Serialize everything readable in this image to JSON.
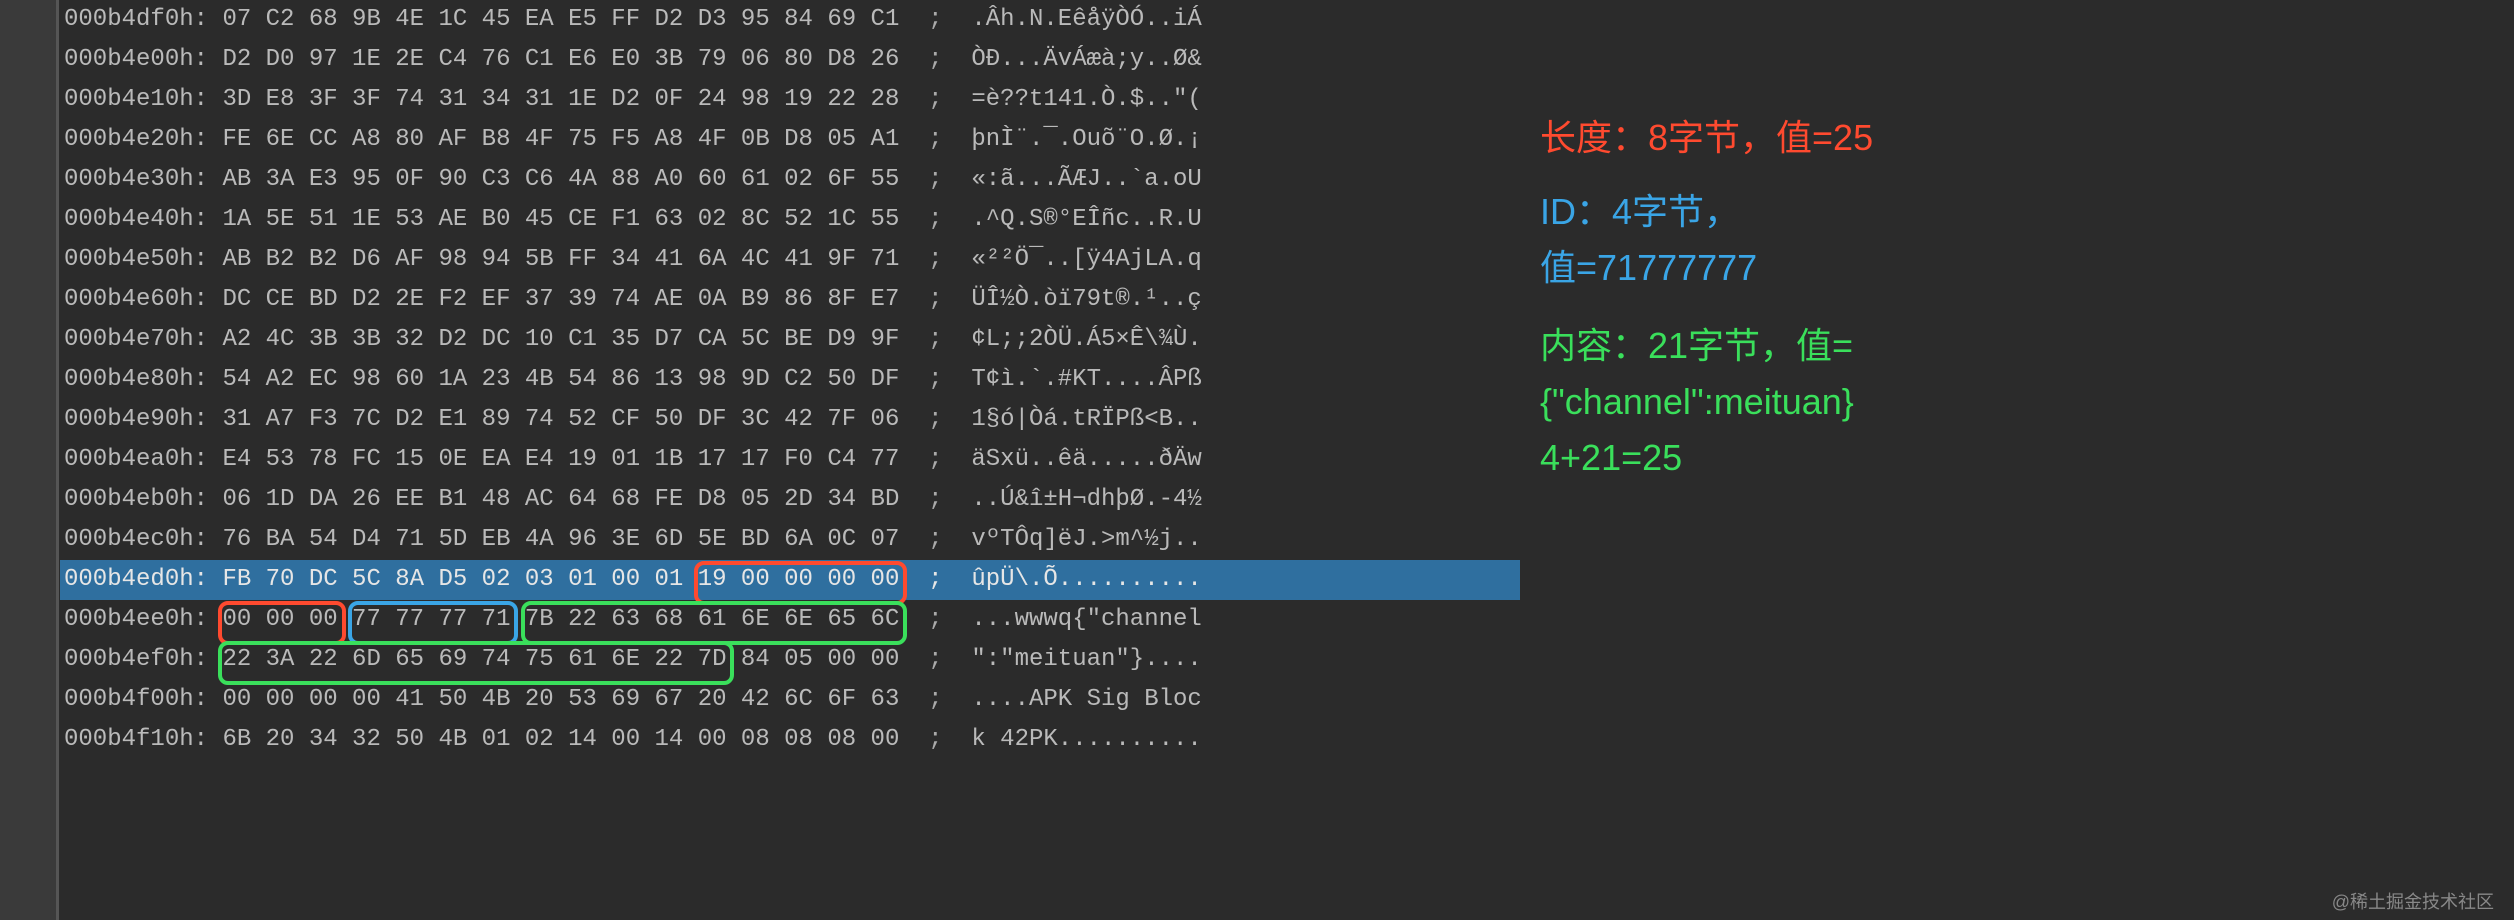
{
  "lines": [
    {
      "offset": "000b4df0h:",
      "bytes": "07 C2 68 9B 4E 1C 45 EA E5 FF D2 D3 95 84 69 C1",
      "ascii": ".Âh.N.EêåÿÒÓ..iÁ",
      "hl": false
    },
    {
      "offset": "000b4e00h:",
      "bytes": "D2 D0 97 1E 2E C4 76 C1 E6 E0 3B 79 06 80 D8 26",
      "ascii": "ÒÐ...ÄvÁæà;y..Ø&",
      "hl": false
    },
    {
      "offset": "000b4e10h:",
      "bytes": "3D E8 3F 3F 74 31 34 31 1E D2 0F 24 98 19 22 28",
      "ascii": "=è??t141.Ò.$..\"(",
      "hl": false
    },
    {
      "offset": "000b4e20h:",
      "bytes": "FE 6E CC A8 80 AF B8 4F 75 F5 A8 4F 0B D8 05 A1",
      "ascii": "þnÌ¨.¯.Ouõ¨O.Ø.¡",
      "hl": false
    },
    {
      "offset": "000b4e30h:",
      "bytes": "AB 3A E3 95 0F 90 C3 C6 4A 88 A0 60 61 02 6F 55",
      "ascii": "«:ã...ÃÆJ..`a.oU",
      "hl": false
    },
    {
      "offset": "000b4e40h:",
      "bytes": "1A 5E 51 1E 53 AE B0 45 CE F1 63 02 8C 52 1C 55",
      "ascii": ".^Q.S®°EÎñc..R.U",
      "hl": false
    },
    {
      "offset": "000b4e50h:",
      "bytes": "AB B2 B2 D6 AF 98 94 5B FF 34 41 6A 4C 41 9F 71",
      "ascii": "«²²Ö¯..[ÿ4AjLA.q",
      "hl": false
    },
    {
      "offset": "000b4e60h:",
      "bytes": "DC CE BD D2 2E F2 EF 37 39 74 AE 0A B9 86 8F E7",
      "ascii": "ÜÎ½Ò.òï79t®.¹..ç",
      "hl": false
    },
    {
      "offset": "000b4e70h:",
      "bytes": "A2 4C 3B 3B 32 D2 DC 10 C1 35 D7 CA 5C BE D9 9F",
      "ascii": "¢L;;2ÒÜ.Á5×Ê\\¾Ù.",
      "hl": false
    },
    {
      "offset": "000b4e80h:",
      "bytes": "54 A2 EC 98 60 1A 23 4B 54 86 13 98 9D C2 50 DF",
      "ascii": "T¢ì.`.#KT....ÂPß",
      "hl": false
    },
    {
      "offset": "000b4e90h:",
      "bytes": "31 A7 F3 7C D2 E1 89 74 52 CF 50 DF 3C 42 7F 06",
      "ascii": "1§ó|Òá.tRÏPß<B..",
      "hl": false
    },
    {
      "offset": "000b4ea0h:",
      "bytes": "E4 53 78 FC 15 0E EA E4 19 01 1B 17 17 F0 C4 77",
      "ascii": "äSxü..êä.....ðÄw",
      "hl": false
    },
    {
      "offset": "000b4eb0h:",
      "bytes": "06 1D DA 26 EE B1 48 AC 64 68 FE D8 05 2D 34 BD",
      "ascii": "..Ú&î±H¬dhþØ.-4½",
      "hl": false
    },
    {
      "offset": "000b4ec0h:",
      "bytes": "76 BA 54 D4 71 5D EB 4A 96 3E 6D 5E BD 6A 0C 07",
      "ascii": "vºTÔq]ëJ.>m^½j..",
      "hl": false
    },
    {
      "offset": "000b4ed0h:",
      "bytes": "FB 70 DC 5C 8A D5 02 03 01 00 01 19 00 00 00 00",
      "ascii": "ûpÜ\\.Õ..........",
      "hl": true
    },
    {
      "offset": "000b4ee0h:",
      "bytes": "00 00 00 77 77 77 71 7B 22 63 68 61 6E 6E 65 6C",
      "ascii": "...wwwq{\"channel",
      "hl": false
    },
    {
      "offset": "000b4ef0h:",
      "bytes": "22 3A 22 6D 65 69 74 75 61 6E 22 7D 84 05 00 00",
      "ascii": "\":\"meituan\"}....",
      "hl": false
    },
    {
      "offset": "000b4f00h:",
      "bytes": "00 00 00 00 41 50 4B 20 53 69 67 20 42 6C 6F 63",
      "ascii": "....APK Sig Bloc",
      "hl": false
    },
    {
      "offset": "000b4f10h:",
      "bytes": "6B 20 34 32 50 4B 01 02 14 00 14 00 08 08 08 00",
      "ascii": "k 42PK..........",
      "hl": false
    }
  ],
  "boxes": {
    "red1": {
      "row": 14,
      "colStart": 11,
      "colEnd": 15
    },
    "red2": {
      "row": 15,
      "colStart": 0,
      "colEnd": 2
    },
    "blue": {
      "row": 15,
      "colStart": 3,
      "colEnd": 6
    },
    "green1": {
      "row": 15,
      "colStart": 7,
      "colEnd": 15
    },
    "green2": {
      "row": 16,
      "colStart": 0,
      "colEnd": 11
    }
  },
  "anno": {
    "red": "长度：8字节，值=25",
    "blue1": "ID：4字节，",
    "blue2": "值=71777777",
    "green1": "内容：21字节，值=",
    "green2": "{\"channel\":meituan}",
    "green3": " 4+21=25"
  },
  "watermark": "@稀土掘金技术社区"
}
